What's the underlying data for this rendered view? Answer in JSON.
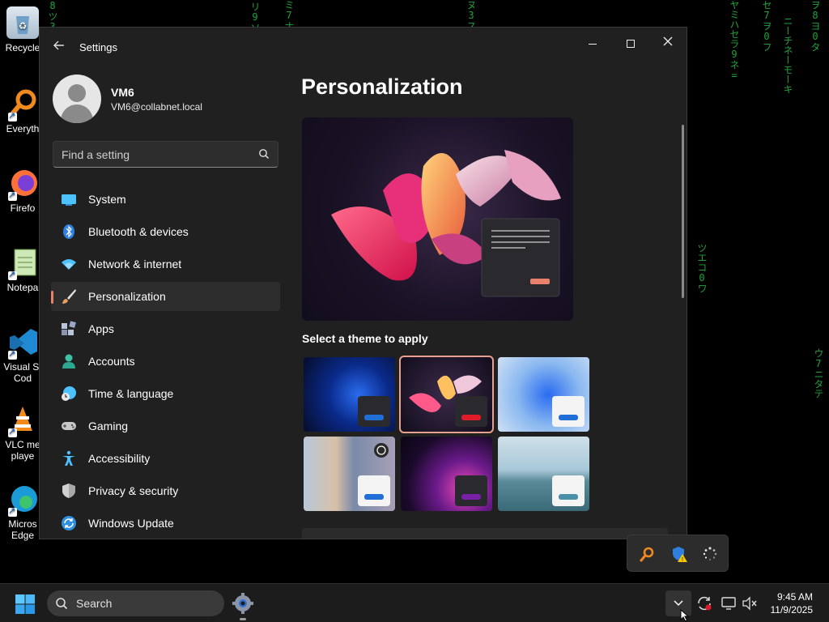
{
  "desktop": {
    "matrix_columns": [
      "8ツ3ロ6ケ",
      "リ9ソ4カ",
      "ミ7ナセ2",
      "ヌ3ス1ウ",
      "ヤミハセラ9ネ=",
      "セ7ヲ0フ",
      "ニーチネーモーキ",
      "ヲ8ヨ0タ",
      "ツエコ0ワ",
      "ウ7ニタテ"
    ],
    "icons": [
      {
        "label": "Recycle",
        "icon": "recycle-bin-icon"
      },
      {
        "label": "Everyth",
        "icon": "everything-search-icon"
      },
      {
        "label": "Firefo",
        "icon": "firefox-icon"
      },
      {
        "label": "Notepa",
        "icon": "notepad-icon"
      },
      {
        "label": "Visual St Cod",
        "icon": "vscode-icon"
      },
      {
        "label": "VLC me playe",
        "icon": "vlc-icon"
      },
      {
        "label": "Micros Edge",
        "icon": "edge-icon"
      }
    ]
  },
  "window": {
    "title": "Settings",
    "controls": {
      "minimize": "Minimize",
      "maximize": "Maximize",
      "close": "Close"
    }
  },
  "user": {
    "name": "VM6",
    "email": "VM6@collabnet.local"
  },
  "search": {
    "placeholder": "Find a setting"
  },
  "nav": {
    "items": [
      {
        "label": "System",
        "icon": "system-icon",
        "color": "#4cc2ff"
      },
      {
        "label": "Bluetooth & devices",
        "icon": "bluetooth-icon",
        "color": "#2f7fe0"
      },
      {
        "label": "Network & internet",
        "icon": "wifi-icon",
        "color": "#4cc2ff"
      },
      {
        "label": "Personalization",
        "icon": "brush-icon",
        "color": "#e8a060",
        "active": true
      },
      {
        "label": "Apps",
        "icon": "apps-icon",
        "color": "#9aa8c8"
      },
      {
        "label": "Accounts",
        "icon": "account-icon",
        "color": "#3fc2a8"
      },
      {
        "label": "Time & language",
        "icon": "globe-clock-icon",
        "color": "#4cc2ff"
      },
      {
        "label": "Gaming",
        "icon": "gamepad-icon",
        "color": "#b8b8b8"
      },
      {
        "label": "Accessibility",
        "icon": "accessibility-icon",
        "color": "#4cc2ff"
      },
      {
        "label": "Privacy & security",
        "icon": "shield-icon",
        "color": "#a8a8a8"
      },
      {
        "label": "Windows Update",
        "icon": "update-icon",
        "color": "#4cc2ff"
      }
    ]
  },
  "main": {
    "title": "Personalization",
    "themes_label": "Select a theme to apply",
    "themes": [
      {
        "name": "windows-dark-bloom",
        "accent": "#1f6fd6",
        "selected": false
      },
      {
        "name": "glow-flower",
        "accent": "#e01c2a",
        "selected": true
      },
      {
        "name": "windows-light-bloom",
        "accent": "#1f6fd6",
        "selected": false
      },
      {
        "name": "capture-motion-flower",
        "accent": "#1f6fd6",
        "selected": false
      },
      {
        "name": "glow-purple",
        "accent": "#7a1fa8",
        "selected": false
      },
      {
        "name": "flow-lake",
        "accent": "#4a90a8",
        "selected": false
      }
    ]
  },
  "tray_popup": {
    "icons": [
      "everything-icon",
      "defender-warning-icon",
      "loading-icon"
    ]
  },
  "taskbar": {
    "search_label": "Search",
    "time": "9:45 AM",
    "date": "11/9/2025",
    "tray_icons": [
      "sync-icon",
      "network-icon",
      "volume-mute-icon"
    ]
  }
}
